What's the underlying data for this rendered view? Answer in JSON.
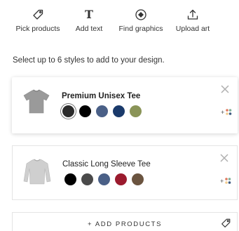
{
  "toolbar": {
    "pick_products": "Pick products",
    "add_text": "Add text",
    "add_text_glyph": "T",
    "find_graphics": "Find graphics",
    "upload_art": "Upload art"
  },
  "instruction": "Select up to 6 styles to add to your design.",
  "products": [
    {
      "name": "Premium Unisex Tee",
      "icon": "gray-tshirt-thumbnail",
      "selected_color_index": 0,
      "colors": [
        "#2b2b2b",
        "#000000",
        "#4a6087",
        "#1a3a6b",
        "#8a9458"
      ]
    },
    {
      "name": "Classic Long Sleeve Tee",
      "icon": "gray-longsleeve-thumbnail",
      "selected_color_index": -1,
      "colors": [
        "#000000",
        "#4a4a4a",
        "#4a6087",
        "#9b1b2e",
        "#6b5440"
      ]
    }
  ],
  "add_products_label": "+ ADD PRODUCTS",
  "more_colors_symbol": "+",
  "icons": {
    "pick": "tag-icon",
    "text": "text-icon",
    "graphics": "graphics-icon",
    "upload": "upload-icon",
    "remove": "close-icon",
    "more_colors": "more-colors-icon"
  }
}
